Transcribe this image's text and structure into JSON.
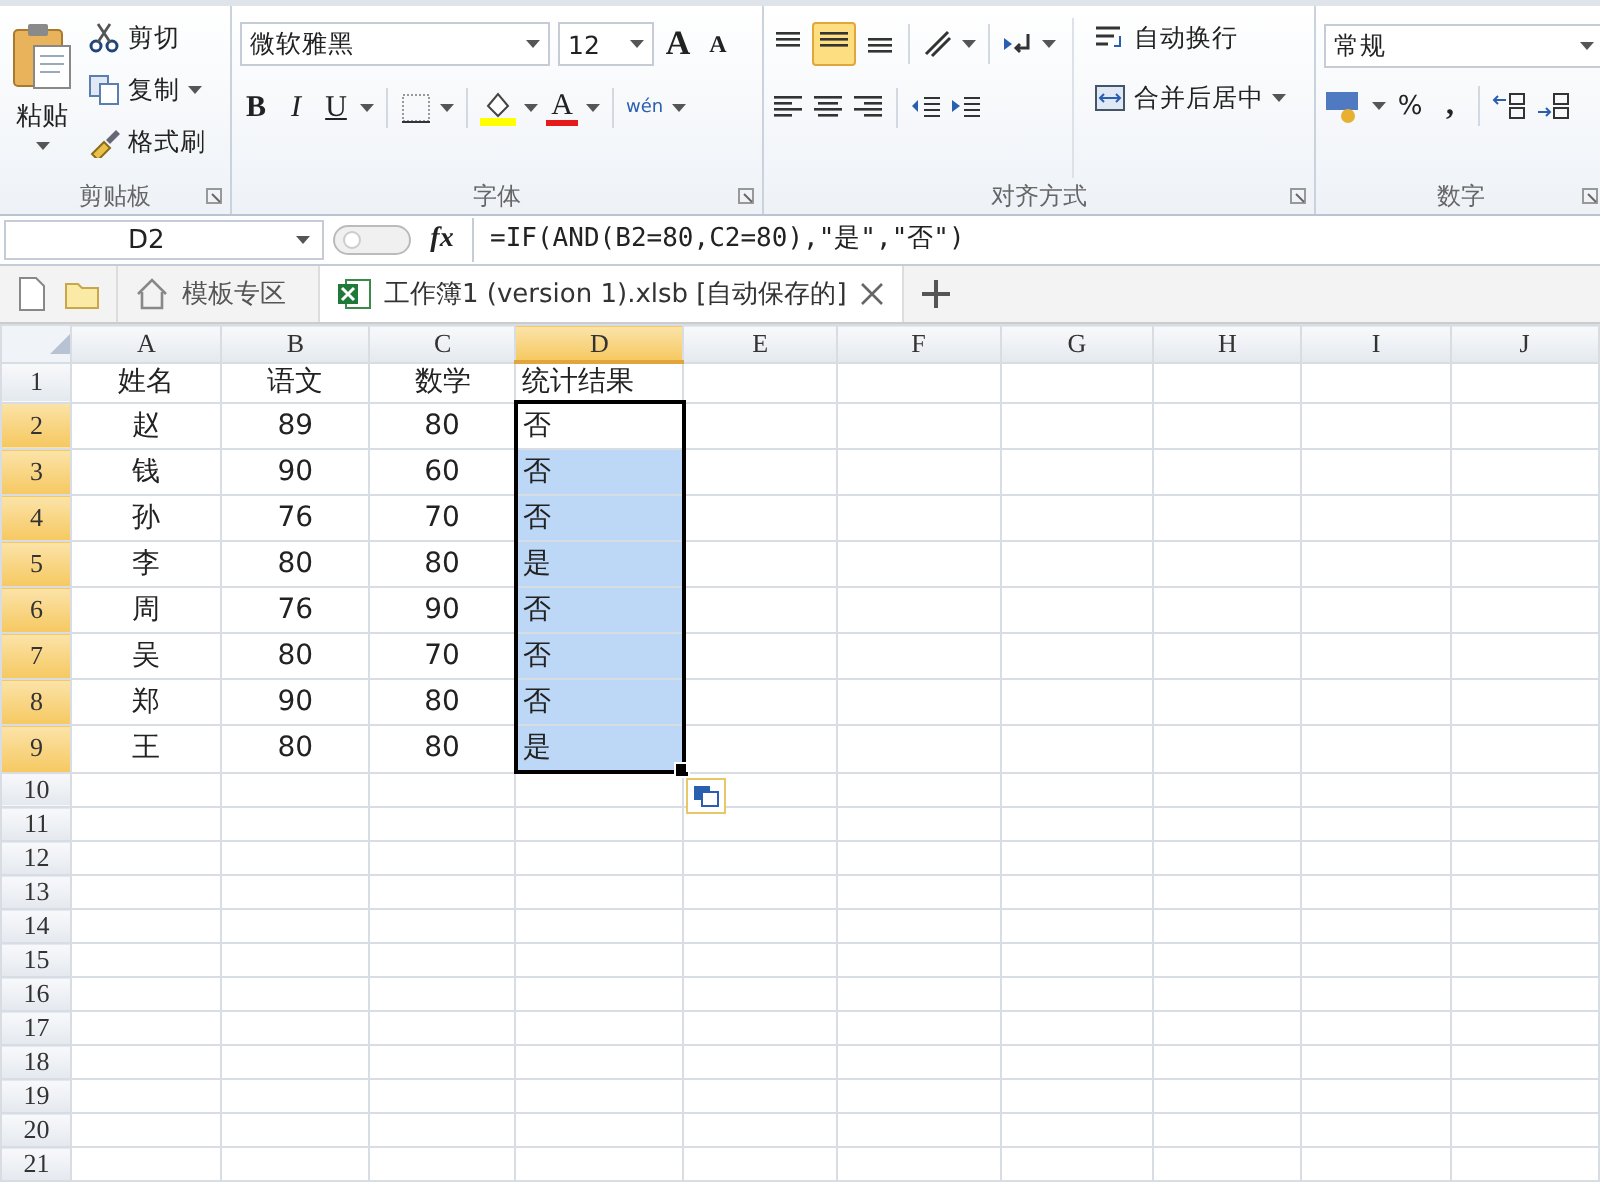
{
  "ribbon": {
    "groups": [
      {
        "kind": "clipboard",
        "label": "剪贴板",
        "paste": "粘贴",
        "items": [
          {
            "kind": "cut",
            "label": "剪切"
          },
          {
            "kind": "copy",
            "label": "复制"
          },
          {
            "kind": "painter",
            "label": "格式刷"
          }
        ]
      },
      {
        "kind": "font",
        "label": "字体",
        "font_name": "微软雅黑",
        "font_size": "12",
        "grow": "A",
        "shrink": "A",
        "bold": "B",
        "italic": "I",
        "underline": "U",
        "font_color": "A",
        "phonetic": "wén"
      },
      {
        "kind": "align",
        "label": "对齐方式",
        "wrap": "自动换行",
        "merge": "合并后居中",
        "middle_selected": true
      },
      {
        "kind": "number",
        "label": "数字",
        "format": "常规",
        "percent": "%",
        "comma": ","
      }
    ]
  },
  "formula_bar": {
    "name_box": "D2",
    "fx": "fx",
    "formula": "=IF(AND(B2=80,C2=80),\"是\",\"否\")"
  },
  "tabs": [
    {
      "kind": "home",
      "label": "模板专区",
      "selected": false
    },
    {
      "kind": "workbook",
      "label": "工作簿1 (version 1).xlsb [自动保存的]",
      "selected": true
    }
  ],
  "columns": [
    {
      "label": "A",
      "selected": false
    },
    {
      "label": "B",
      "selected": false
    },
    {
      "label": "C",
      "selected": false
    },
    {
      "label": "D",
      "selected": true
    },
    {
      "label": "E",
      "selected": false
    },
    {
      "label": "F",
      "selected": false
    },
    {
      "label": "G",
      "selected": false
    },
    {
      "label": "H",
      "selected": false
    },
    {
      "label": "I",
      "selected": false
    },
    {
      "label": "J",
      "selected": false
    }
  ],
  "rows": [
    {
      "header": "1",
      "selected": false,
      "active": false,
      "cells": [
        "姓名",
        "语文",
        "数学",
        "统计结果"
      ]
    },
    {
      "header": "2",
      "selected": true,
      "active": true,
      "cells": [
        "赵",
        "89",
        "80",
        "否"
      ]
    },
    {
      "header": "3",
      "selected": true,
      "active": false,
      "cells": [
        "钱",
        "90",
        "60",
        "否"
      ]
    },
    {
      "header": "4",
      "selected": true,
      "active": false,
      "cells": [
        "孙",
        "76",
        "70",
        "否"
      ]
    },
    {
      "header": "5",
      "selected": true,
      "active": false,
      "cells": [
        "李",
        "80",
        "80",
        "是"
      ]
    },
    {
      "header": "6",
      "selected": true,
      "active": false,
      "cells": [
        "周",
        "76",
        "90",
        "否"
      ]
    },
    {
      "header": "7",
      "selected": true,
      "active": false,
      "cells": [
        "吴",
        "80",
        "70",
        "否"
      ]
    },
    {
      "header": "8",
      "selected": true,
      "active": false,
      "cells": [
        "郑",
        "90",
        "80",
        "否"
      ]
    },
    {
      "header": "9",
      "selected": true,
      "active": false,
      "cells": [
        "王",
        "80",
        "80",
        "是"
      ]
    },
    {
      "header": "10",
      "selected": false,
      "active": false,
      "cells": []
    },
    {
      "header": "11",
      "selected": false,
      "active": false,
      "cells": []
    },
    {
      "header": "12",
      "selected": false,
      "active": false,
      "cells": []
    },
    {
      "header": "13",
      "selected": false,
      "active": false,
      "cells": []
    },
    {
      "header": "14",
      "selected": false,
      "active": false,
      "cells": []
    },
    {
      "header": "15",
      "selected": false,
      "active": false,
      "cells": []
    },
    {
      "header": "16",
      "selected": false,
      "active": false,
      "cells": []
    },
    {
      "header": "17",
      "selected": false,
      "active": false,
      "cells": []
    },
    {
      "header": "18",
      "selected": false,
      "active": false,
      "cells": []
    },
    {
      "header": "19",
      "selected": false,
      "active": false,
      "cells": []
    },
    {
      "header": "20",
      "selected": false,
      "active": false,
      "cells": []
    },
    {
      "header": "21",
      "selected": false,
      "active": false,
      "cells": []
    }
  ]
}
